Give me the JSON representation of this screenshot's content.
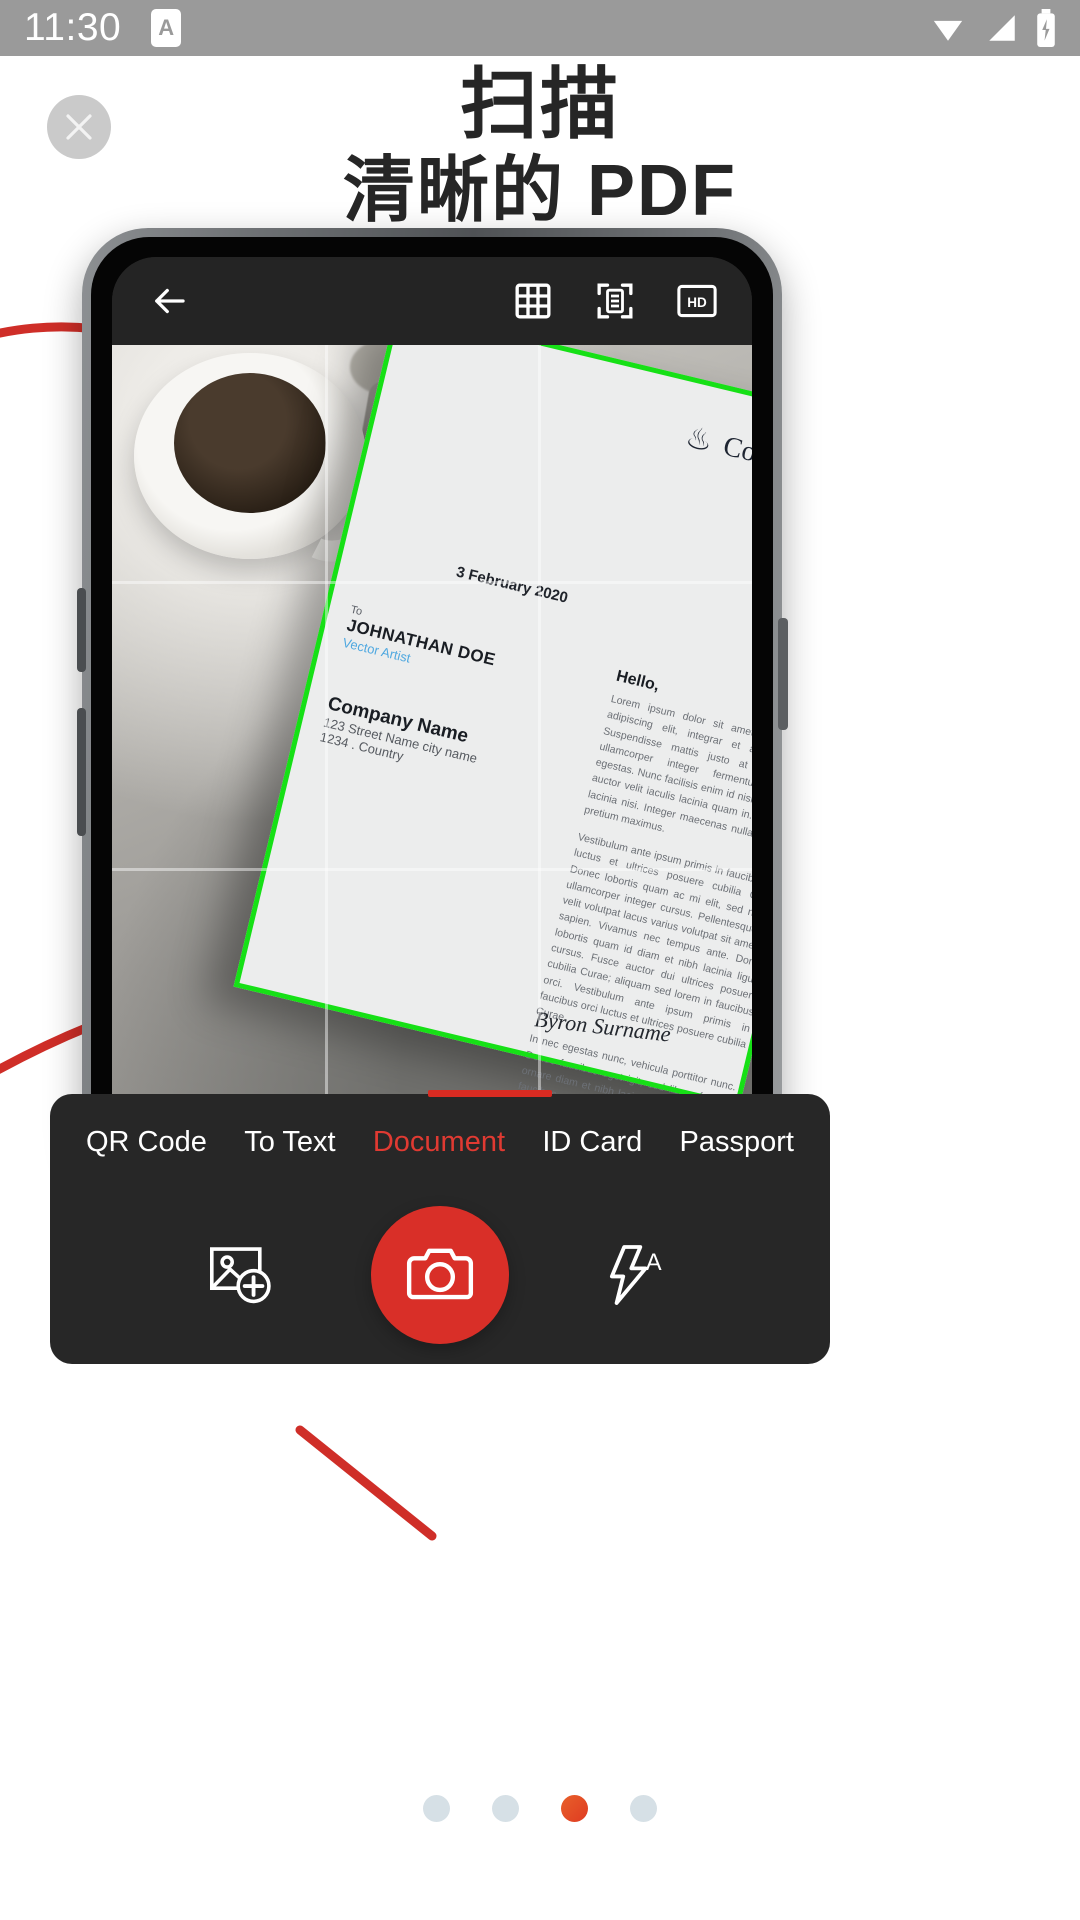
{
  "status_bar": {
    "time": "11:30",
    "app_badge_letter": "A",
    "icons": [
      "wifi-icon",
      "signal-icon",
      "battery-charging-icon"
    ],
    "background": "#9a9a9a"
  },
  "onboarding": {
    "headline_line1": "扫描",
    "headline_line2": "清晰的 PDF",
    "close_label": "×",
    "accent_color": "#d92f28",
    "page_dots": {
      "total": 4,
      "active_index": 2
    }
  },
  "app_toolbar": {
    "back_icon": "arrow-left-icon",
    "actions": [
      {
        "name": "grid-icon",
        "label": "Grid"
      },
      {
        "name": "document-scan-icon",
        "label": "Auto detect"
      },
      {
        "name": "hd-icon",
        "label": "HD"
      }
    ],
    "hd_text": "HD"
  },
  "viewfinder": {
    "detected_edge_color": "#16e016",
    "grid_visible": true,
    "document": {
      "logo_text": "Coffe Studio",
      "date": "3 February 2020",
      "to_label": "To",
      "recipient_name": "JOHNATHAN DOE",
      "recipient_role": "Vector Artist",
      "company_name": "Company Name",
      "company_street": "123 Street Name city name",
      "company_city": "1234 . Country",
      "greeting": "Hello,",
      "paragraph1": "Lorem ipsum dolor sit amet, consectetur adipiscing elit, integrar et aliquet risus. Suspendisse mattis justo at nisl metus ullamcorper integer fermentum ornare egestas. Nunc facilisis enim id nisl tempor ac auctor velit iaculis lacinia quam in. Donec ut lacinia nisi. Integer maecenas nulla vel ante pretium maximus.",
      "paragraph2": "Vestibulum ante ipsum primis in faucibus orci luctus et ultrices posuere cubilia Curae; Donec lobortis quam ac mi elit, sed nostra ullamcorper integer cursus. Pellentesque ac velit volutpat lacus varius volutpat sit amet ut sapien. Vivamus nec tempus ante. Donec lobortis quam id diam et nibh lacinia ligula cursus. Fusce auctor dui ultrices posuere cubilia Curae; aliquam sed lorem in faucibus orci. Vestibulum ante ipsum primis in faucibus orci luctus et ultrices posuere cubilia Curae",
      "paragraph3": "In nec egestas nunc, vehicula porttitor nunc. Donec faucibus eget igit, sed libero facilisis ornare diam et nibh lacinia sit amet pulvinar faucibus orci luctus et ultrices; posuere cubilae Curae. Nunc a commodo erat, egestas purus.",
      "signature": "Byron Surname"
    }
  },
  "controls": {
    "tabs": [
      {
        "label": "QR Code",
        "active": false
      },
      {
        "label": "To Text",
        "active": false
      },
      {
        "label": "Document",
        "active": true
      },
      {
        "label": "ID Card",
        "active": false
      },
      {
        "label": "Passport",
        "active": false
      }
    ],
    "gallery_icon": "add-image-icon",
    "shutter_icon": "camera-icon",
    "flash_icon": "flash-auto-icon",
    "flash_mode_letter": "A",
    "shutter_color": "#d92f28",
    "panel_color": "#272727"
  }
}
